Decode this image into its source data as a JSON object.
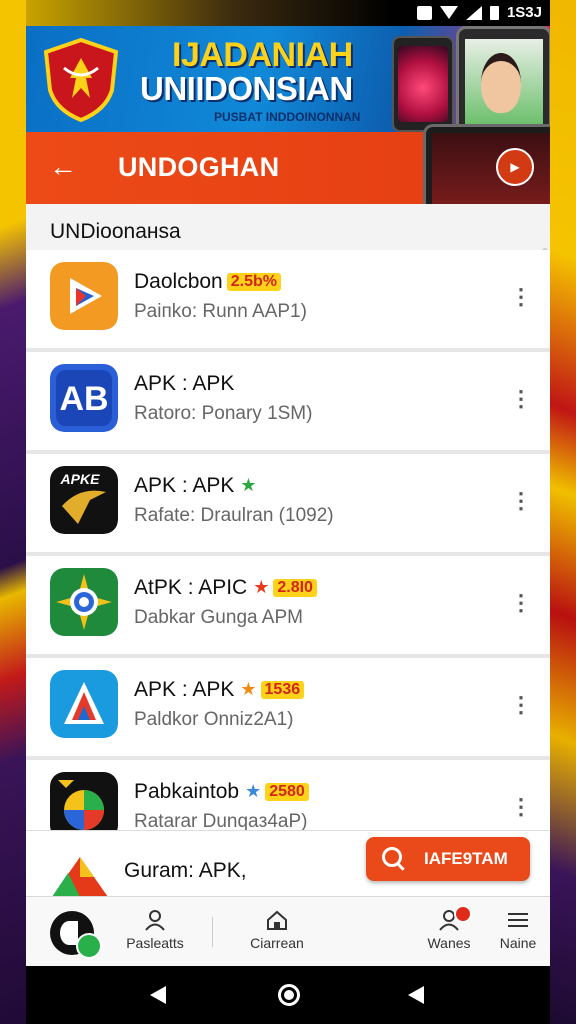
{
  "status_bar": {
    "time": "1S3J"
  },
  "banner": {
    "title": "IJADANIAH",
    "subtitle": "UNIIDONSIAN",
    "tagline": "PUSBAT INDDOINONNAN"
  },
  "header": {
    "title": "UNDOGHAN"
  },
  "section": {
    "label": "UNDioonaнsa"
  },
  "apps": [
    {
      "name": "Daolcbon",
      "badge": "2.5b%",
      "star": "",
      "sub": "Paiпko: Runn AAP1)",
      "icon": "orange-play-icon"
    },
    {
      "name": "APK : APK",
      "badge": "",
      "star": "",
      "sub": "Ratoro: Ponary 1SM)",
      "icon": "ab-blue-icon"
    },
    {
      "name": "APK : APK",
      "badge": "",
      "star": "★",
      "sub": "Rafate: Draulran (1092)",
      "icon": "black-gold-icon"
    },
    {
      "name": "AtPK : APIC",
      "badge": "2.8I0",
      "star": "★",
      "sub": "Dabkar Gunga APM",
      "icon": "green-compass-icon"
    },
    {
      "name": "APK : APK",
      "badge": "1536",
      "star": "★",
      "sub": "Paldkor Onniz2A1)",
      "icon": "blue-triangle-icon"
    },
    {
      "name": "Pabkaintob",
      "badge": "2580",
      "star": "★",
      "sub": "Ratarar Dunqaз4aP)",
      "icon": "multicolor-icon"
    }
  ],
  "promo": {
    "text": "Guram: APK,",
    "button": "IAFE9TAM"
  },
  "nav": {
    "items": [
      {
        "label": "Pasleatts"
      },
      {
        "label": "Ciarrean"
      },
      {
        "label": "Wanes"
      },
      {
        "label": "Naine"
      }
    ]
  },
  "colors": {
    "accent": "#ea4a1a",
    "badge": "#ffd21a",
    "banner": "#1189d8"
  }
}
